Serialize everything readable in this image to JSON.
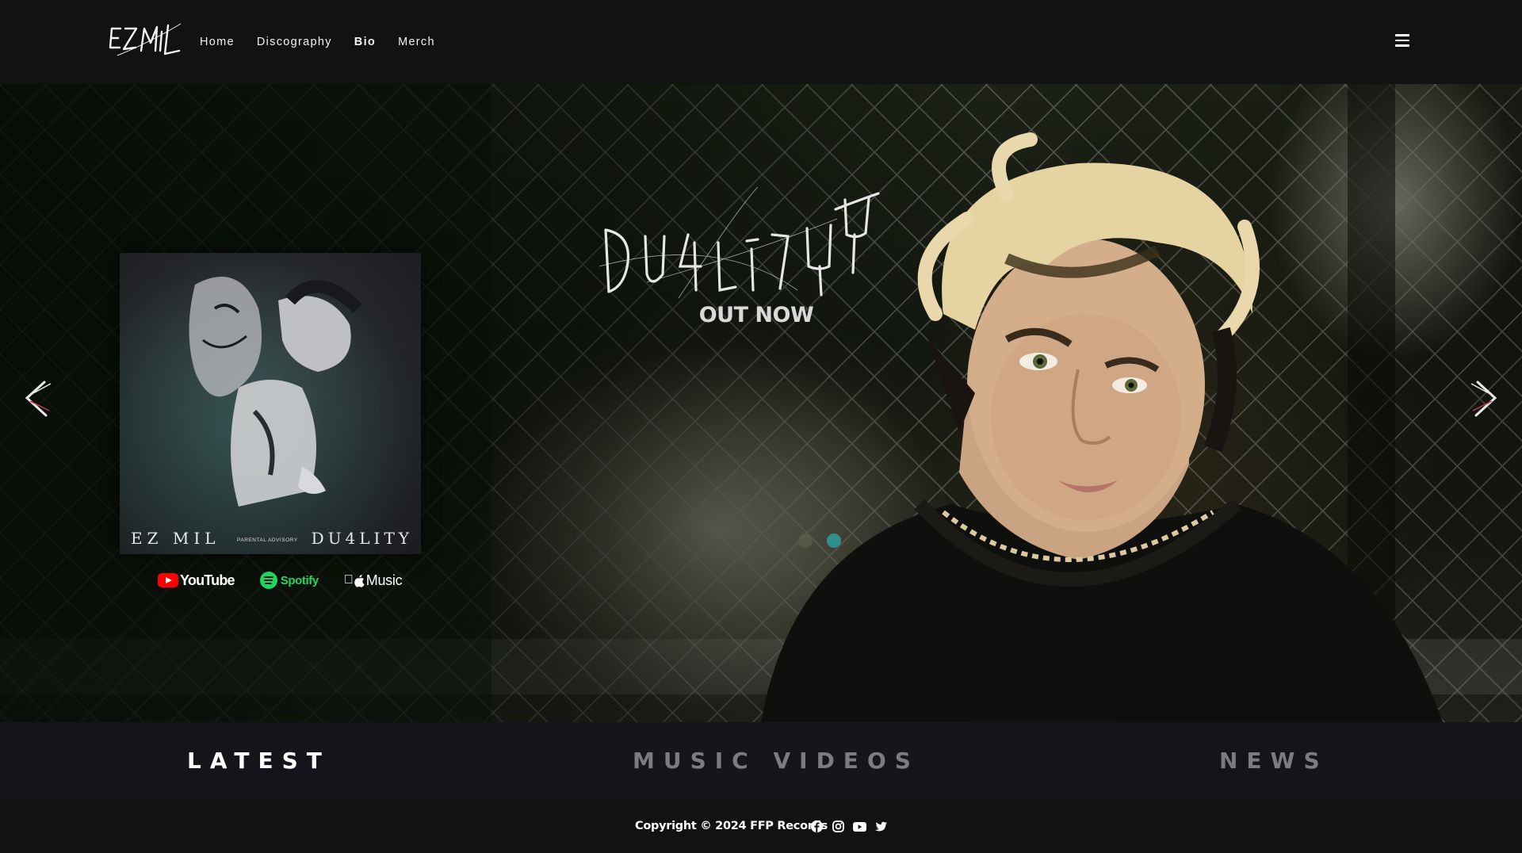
{
  "header": {
    "logo_text": "EZ MIL",
    "nav": [
      {
        "label": "Home",
        "active": false
      },
      {
        "label": "Discography",
        "active": false
      },
      {
        "label": "Bio",
        "active": true
      },
      {
        "label": "Merch",
        "active": false
      }
    ],
    "menu_icon": "hamburger-icon"
  },
  "hero": {
    "title": "DU4LITY",
    "subtitle": "OUT NOW",
    "album": {
      "artist": "EZ MIL",
      "title": "DU4LITY",
      "advisory": "PARENTAL ADVISORY"
    },
    "streaming": {
      "youtube": "YouTube",
      "spotify": "Spotify",
      "apple_music": "Music"
    },
    "prev_icon": "chevron-left-icon",
    "next_icon": "chevron-right-icon",
    "dots": [
      {
        "color": "#5a5e4a",
        "active": false
      },
      {
        "color": "#2f8f8a",
        "active": true
      }
    ]
  },
  "tabs": [
    {
      "label": "LATEST",
      "active": true
    },
    {
      "label": "MUSIC VIDEOS",
      "active": false
    },
    {
      "label": "NEWS",
      "active": false
    }
  ],
  "footer": {
    "copyright": "Copyright © 2024 FFP Records",
    "social": [
      "facebook-icon",
      "instagram-icon",
      "youtube-icon",
      "twitter-icon"
    ]
  },
  "colors": {
    "header_bg": "#121213",
    "tab_active": "#ffffff",
    "tab_inactive": "#7b7b80",
    "spotify_green": "#1ed760",
    "youtube_red": "#ff0000"
  }
}
